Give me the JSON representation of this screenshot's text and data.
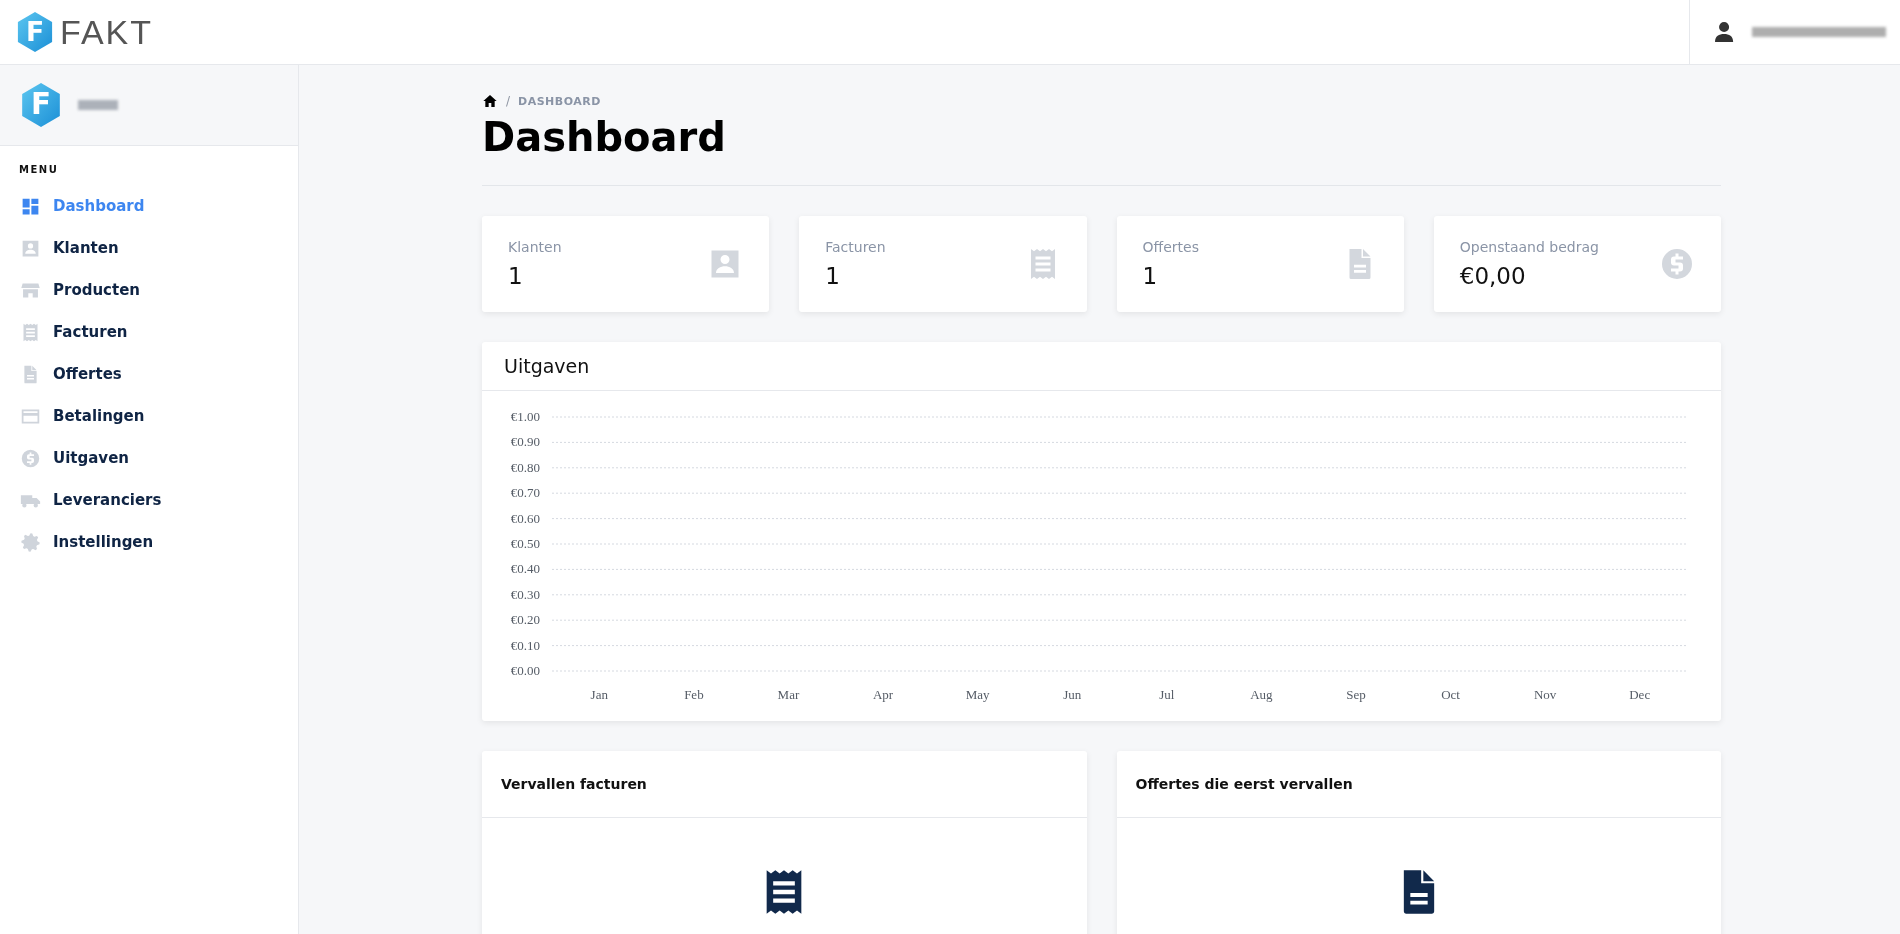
{
  "header": {
    "logo_mark": "F",
    "logo_text": "FAKT"
  },
  "sidebar": {
    "brand_mark": "F",
    "menu_label": "MENU",
    "items": [
      {
        "label": "Dashboard",
        "selected": true
      },
      {
        "label": "Klanten",
        "selected": false
      },
      {
        "label": "Producten",
        "selected": false
      },
      {
        "label": "Facturen",
        "selected": false
      },
      {
        "label": "Offertes",
        "selected": false
      },
      {
        "label": "Betalingen",
        "selected": false
      },
      {
        "label": "Uitgaven",
        "selected": false
      },
      {
        "label": "Leveranciers",
        "selected": false
      },
      {
        "label": "Instellingen",
        "selected": false
      }
    ]
  },
  "breadcrumb": {
    "separator": "/",
    "current": "DASHBOARD"
  },
  "page_title": "Dashboard",
  "stats": [
    {
      "label": "Klanten",
      "value": "1"
    },
    {
      "label": "Facturen",
      "value": "1"
    },
    {
      "label": "Offertes",
      "value": "1"
    },
    {
      "label": "Openstaand bedrag",
      "value": "€0,00"
    }
  ],
  "expenses": {
    "title": "Uitgaven",
    "chart_data": {
      "type": "line",
      "grid": true,
      "categories": [
        "Jan",
        "Feb",
        "Mar",
        "Apr",
        "May",
        "Jun",
        "Jul",
        "Aug",
        "Sep",
        "Oct",
        "Nov",
        "Dec"
      ],
      "ylim": [
        0,
        1
      ],
      "yticks": [
        {
          "value": 0,
          "label": "€0.00"
        },
        {
          "value": 0.1,
          "label": "€0.10"
        },
        {
          "value": 0.2,
          "label": "€0.20"
        },
        {
          "value": 0.3,
          "label": "€0.30"
        },
        {
          "value": 0.4,
          "label": "€0.40"
        },
        {
          "value": 0.5,
          "label": "€0.50"
        },
        {
          "value": 0.6,
          "label": "€0.60"
        },
        {
          "value": 0.7,
          "label": "€0.70"
        },
        {
          "value": 0.8,
          "label": "€0.80"
        },
        {
          "value": 0.9,
          "label": "€0.90"
        },
        {
          "value": 1,
          "label": "€1.00"
        }
      ]
    }
  },
  "panels": [
    {
      "title": "Vervallen facturen"
    },
    {
      "title": "Offertes die eerst vervallen"
    }
  ]
}
